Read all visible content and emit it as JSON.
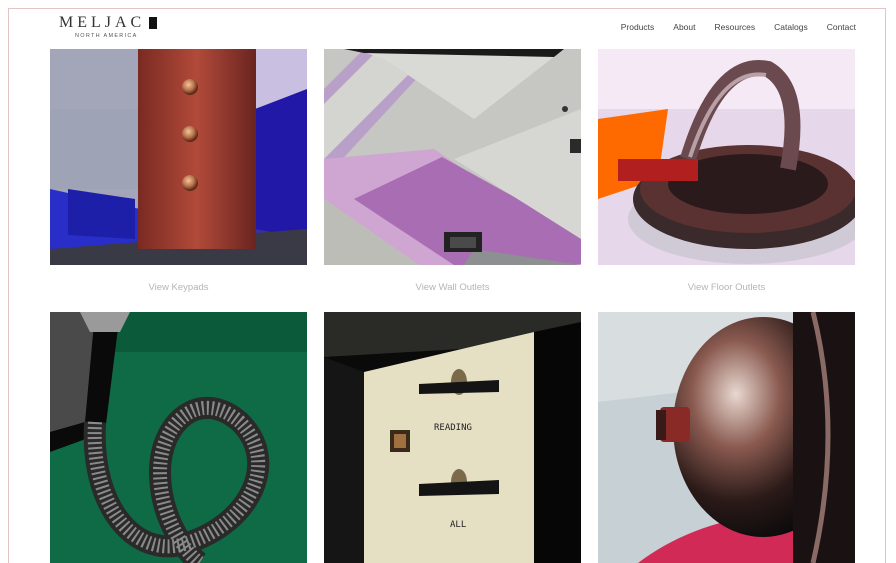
{
  "brand": {
    "name": "MELJAC",
    "subtitle": "NORTH AMERICA"
  },
  "nav": [
    "Products",
    "About",
    "Resources",
    "Catalogs",
    "Contact"
  ],
  "tiles": [
    {
      "caption": "View Keypads"
    },
    {
      "caption": "View Wall Outlets"
    },
    {
      "caption": "View Floor Outlets"
    },
    {
      "caption": ""
    },
    {
      "caption": "",
      "engravings": [
        "READING",
        "ALL"
      ]
    },
    {
      "caption": ""
    }
  ]
}
